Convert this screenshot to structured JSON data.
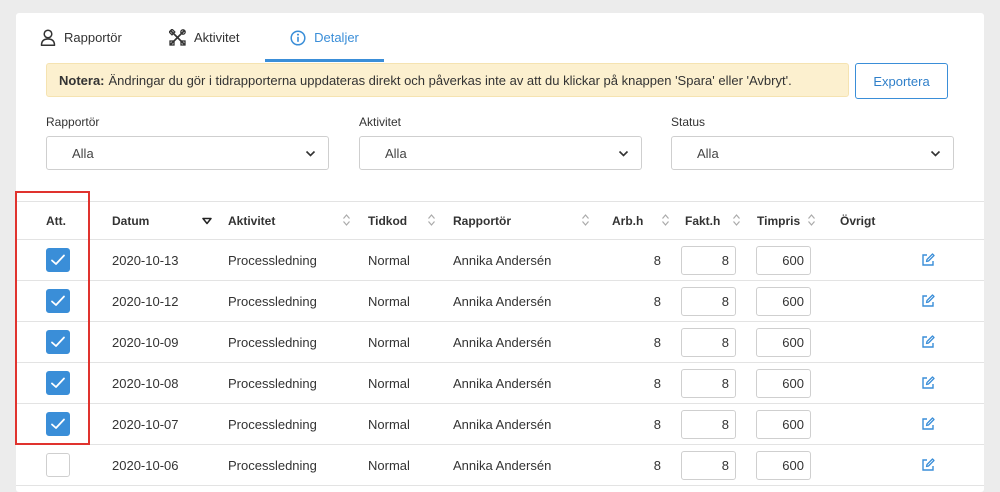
{
  "tabs": [
    {
      "label": "Rapportör",
      "icon": "person-icon",
      "active": false
    },
    {
      "label": "Aktivitet",
      "icon": "tools-icon",
      "active": false
    },
    {
      "label": "Detaljer",
      "icon": "info-icon",
      "active": true
    }
  ],
  "notice": {
    "strong": "Notera:",
    "text": "Ändringar du gör i tidrapporterna uppdateras direkt och påverkas inte av att du klickar på knappen 'Spara' eller 'Avbryt'."
  },
  "export_label": "Exportera",
  "filters": {
    "rapportor": {
      "label": "Rapportör",
      "value": "Alla"
    },
    "aktivitet": {
      "label": "Aktivitet",
      "value": "Alla"
    },
    "status": {
      "label": "Status",
      "value": "Alla"
    }
  },
  "columns": {
    "att": "Att.",
    "datum": "Datum",
    "aktivitet": "Aktivitet",
    "tidkod": "Tidkod",
    "rapportor": "Rapportör",
    "arbh": "Arb.h",
    "fakth": "Fakt.h",
    "timpris": "Timpris",
    "ovrigt": "Övrigt"
  },
  "rows": [
    {
      "checked": true,
      "datum": "2020-10-13",
      "aktivitet": "Processledning",
      "tidkod": "Normal",
      "rapportor": "Annika Andersén",
      "arbh": "8",
      "fakth": "8",
      "timpris": "600"
    },
    {
      "checked": true,
      "datum": "2020-10-12",
      "aktivitet": "Processledning",
      "tidkod": "Normal",
      "rapportor": "Annika Andersén",
      "arbh": "8",
      "fakth": "8",
      "timpris": "600"
    },
    {
      "checked": true,
      "datum": "2020-10-09",
      "aktivitet": "Processledning",
      "tidkod": "Normal",
      "rapportor": "Annika Andersén",
      "arbh": "8",
      "fakth": "8",
      "timpris": "600"
    },
    {
      "checked": true,
      "datum": "2020-10-08",
      "aktivitet": "Processledning",
      "tidkod": "Normal",
      "rapportor": "Annika Andersén",
      "arbh": "8",
      "fakth": "8",
      "timpris": "600"
    },
    {
      "checked": true,
      "datum": "2020-10-07",
      "aktivitet": "Processledning",
      "tidkod": "Normal",
      "rapportor": "Annika Andersén",
      "arbh": "8",
      "fakth": "8",
      "timpris": "600"
    },
    {
      "checked": false,
      "datum": "2020-10-06",
      "aktivitet": "Processledning",
      "tidkod": "Normal",
      "rapportor": "Annika Andersén",
      "arbh": "8",
      "fakth": "8",
      "timpris": "600"
    }
  ],
  "colors": {
    "accent": "#3a8ed8",
    "notice_bg": "#fcf0cf",
    "highlight": "#e0332e"
  }
}
